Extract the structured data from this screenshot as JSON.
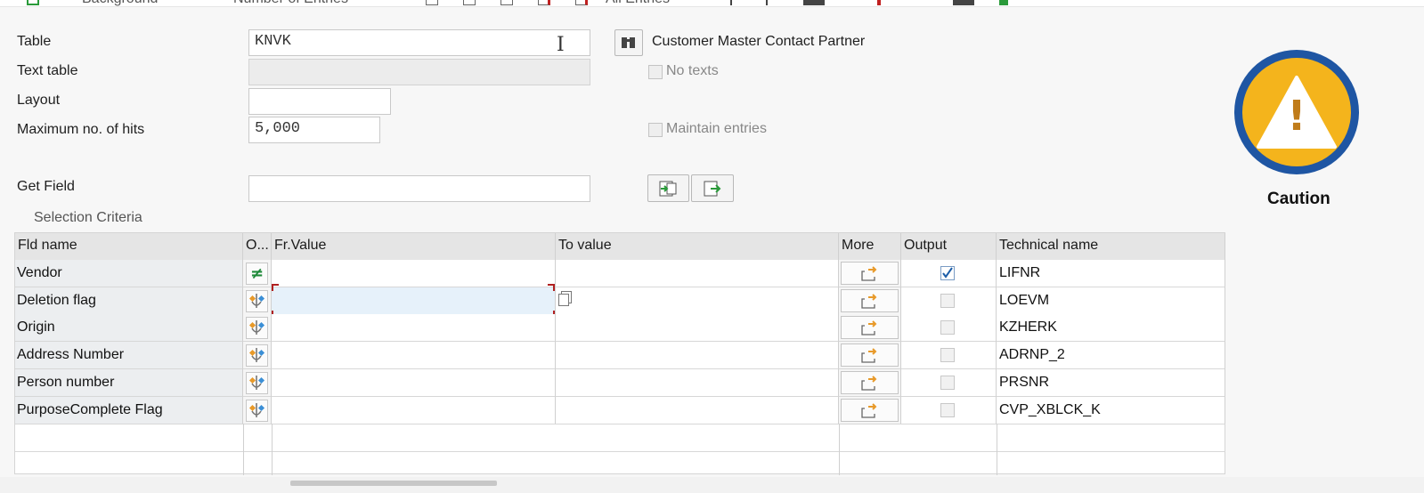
{
  "toolbar": {
    "background_label": "Background",
    "number_of_entries_label": "Number of Entries",
    "all_entries_label": "All Entries"
  },
  "form": {
    "table_label": "Table",
    "table_value": "KNVK",
    "table_description": "Customer Master Contact Partner",
    "text_table_label": "Text table",
    "text_table_value": "",
    "no_texts_label": "No texts",
    "layout_label": "Layout",
    "layout_value": "",
    "max_hits_label": "Maximum no. of hits",
    "max_hits_value": "5,000",
    "maintain_entries_label": "Maintain entries",
    "get_field_label": "Get Field",
    "get_field_value": ""
  },
  "caution": {
    "label": "Caution",
    "symbol": "!",
    "ring_color": "#1f56a3",
    "fill_color": "#f4b41c"
  },
  "selection": {
    "title": "Selection Criteria",
    "columns": {
      "fld_name": "Fld name",
      "option": "O...",
      "from_value": "Fr.Value",
      "to_value": "To value",
      "more": "More",
      "output": "Output",
      "technical_name": "Technical name"
    },
    "rows": [
      {
        "field": "Vendor",
        "operator": "not-equal",
        "output_checked": true,
        "technical": "LIFNR"
      },
      {
        "field": "Deletion flag",
        "operator": "select-options",
        "output_checked": false,
        "technical": "LOEVM"
      },
      {
        "field": "Origin",
        "operator": "select-options",
        "output_checked": false,
        "technical": "KZHERK"
      },
      {
        "field": "Address Number",
        "operator": "select-options",
        "output_checked": false,
        "technical": "ADRNP_2"
      },
      {
        "field": "Person number",
        "operator": "select-options",
        "output_checked": false,
        "technical": "PRSNR"
      },
      {
        "field": "PurposeComplete Flag",
        "operator": "select-options",
        "output_checked": false,
        "technical": "CVP_XBLCK_K"
      }
    ]
  }
}
